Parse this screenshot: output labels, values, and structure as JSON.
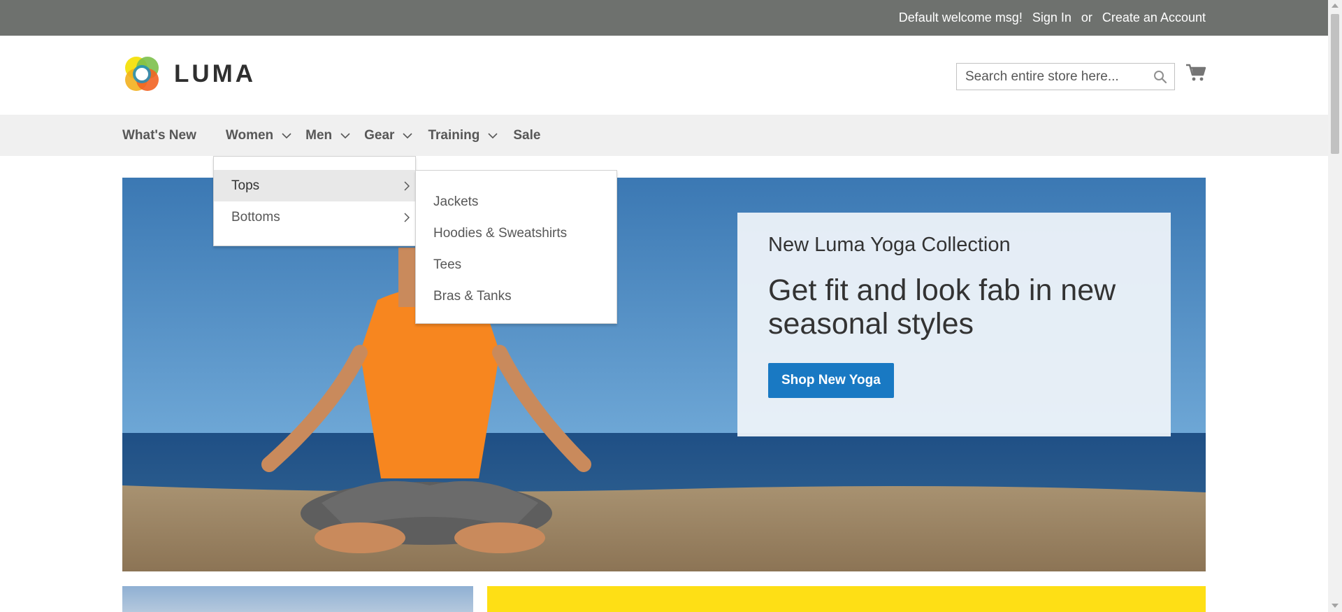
{
  "topbar": {
    "welcome": "Default welcome msg!",
    "sign_in": "Sign In",
    "or": "or",
    "create_account": "Create an Account"
  },
  "header": {
    "logo_text": "LUMA",
    "search_placeholder": "Search entire store here...",
    "search_value": ""
  },
  "nav": {
    "items": [
      {
        "label": "What's New"
      },
      {
        "label": "Women"
      },
      {
        "label": "Men"
      },
      {
        "label": "Gear"
      },
      {
        "label": "Training"
      },
      {
        "label": "Sale"
      }
    ]
  },
  "dropdown": {
    "level1": [
      {
        "label": "Tops"
      },
      {
        "label": "Bottoms"
      }
    ],
    "level2": [
      {
        "label": "Jackets"
      },
      {
        "label": "Hoodies & Sweatshirts"
      },
      {
        "label": "Tees"
      },
      {
        "label": "Bras & Tanks"
      }
    ]
  },
  "hero": {
    "subtitle": "New Luma Yoga Collection",
    "headline": "Get fit and look fab in new seasonal styles",
    "button": "Shop New Yoga"
  },
  "colors": {
    "topbar": "#6e716e",
    "nav_bg": "#f0f0f0",
    "accent_blue": "#1979c3",
    "yellow_panel": "#fedf15"
  }
}
